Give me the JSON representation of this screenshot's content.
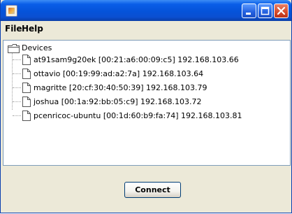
{
  "window": {
    "app_icon": "java-app-icon",
    "controls": [
      "minimize-icon",
      "maximize-icon",
      "close-icon"
    ]
  },
  "menu": {
    "file": "File",
    "help": "Help"
  },
  "tree": {
    "root": {
      "label": "Devices",
      "icon": "folder-icon"
    },
    "devices": [
      {
        "label": "at91sam9g20ek [00:21:a6:00:09:c5] 192.168.103.66",
        "icon": "file-icon"
      },
      {
        "label": "ottavio [00:19:99:ad:a2:7a] 192.168.103.64",
        "icon": "file-icon"
      },
      {
        "label": "magritte [20:cf:30:40:50:39] 192.168.103.79",
        "icon": "file-icon"
      },
      {
        "label": "joshua [00:1a:92:bb:05:c9] 192.168.103.72",
        "icon": "file-icon"
      },
      {
        "label": "pcenricoc-ubuntu [00:1d:60:b9:fa:74] 192.168.103.81",
        "icon": "file-icon"
      }
    ]
  },
  "actions": {
    "connect": "Connect"
  }
}
